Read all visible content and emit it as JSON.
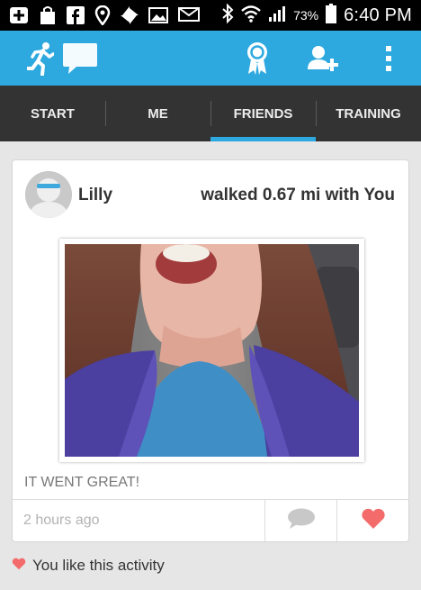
{
  "status_bar": {
    "battery_percent": "73%",
    "time": "6:40 PM",
    "icons": [
      "plus-icon",
      "bag-icon",
      "facebook-icon",
      "location-icon",
      "pinwheel-icon",
      "gallery-icon",
      "email-icon",
      "bluetooth-icon",
      "wifi-icon",
      "signal-icon",
      "battery-icon"
    ]
  },
  "app_bar": {
    "icons": [
      "runner-icon",
      "chat-bubble-icon",
      "award-ribbon-icon",
      "add-friend-icon",
      "overflow-menu-icon"
    ],
    "accent_color": "#2ea9df"
  },
  "tabs": [
    {
      "label": "START",
      "active": false
    },
    {
      "label": "ME",
      "active": false
    },
    {
      "label": "FRIENDS",
      "active": true
    },
    {
      "label": "TRAINING",
      "active": false
    }
  ],
  "activity_card": {
    "user_name": "Lilly",
    "activity_text": "walked 0.67 mi with You",
    "caption": "IT WENT GREAT!",
    "timestamp": "2 hours ago",
    "comment_icon": "comment-icon",
    "like_icon": "heart-icon",
    "like_color": "#f36b6b"
  },
  "like_status": "You like this activity"
}
